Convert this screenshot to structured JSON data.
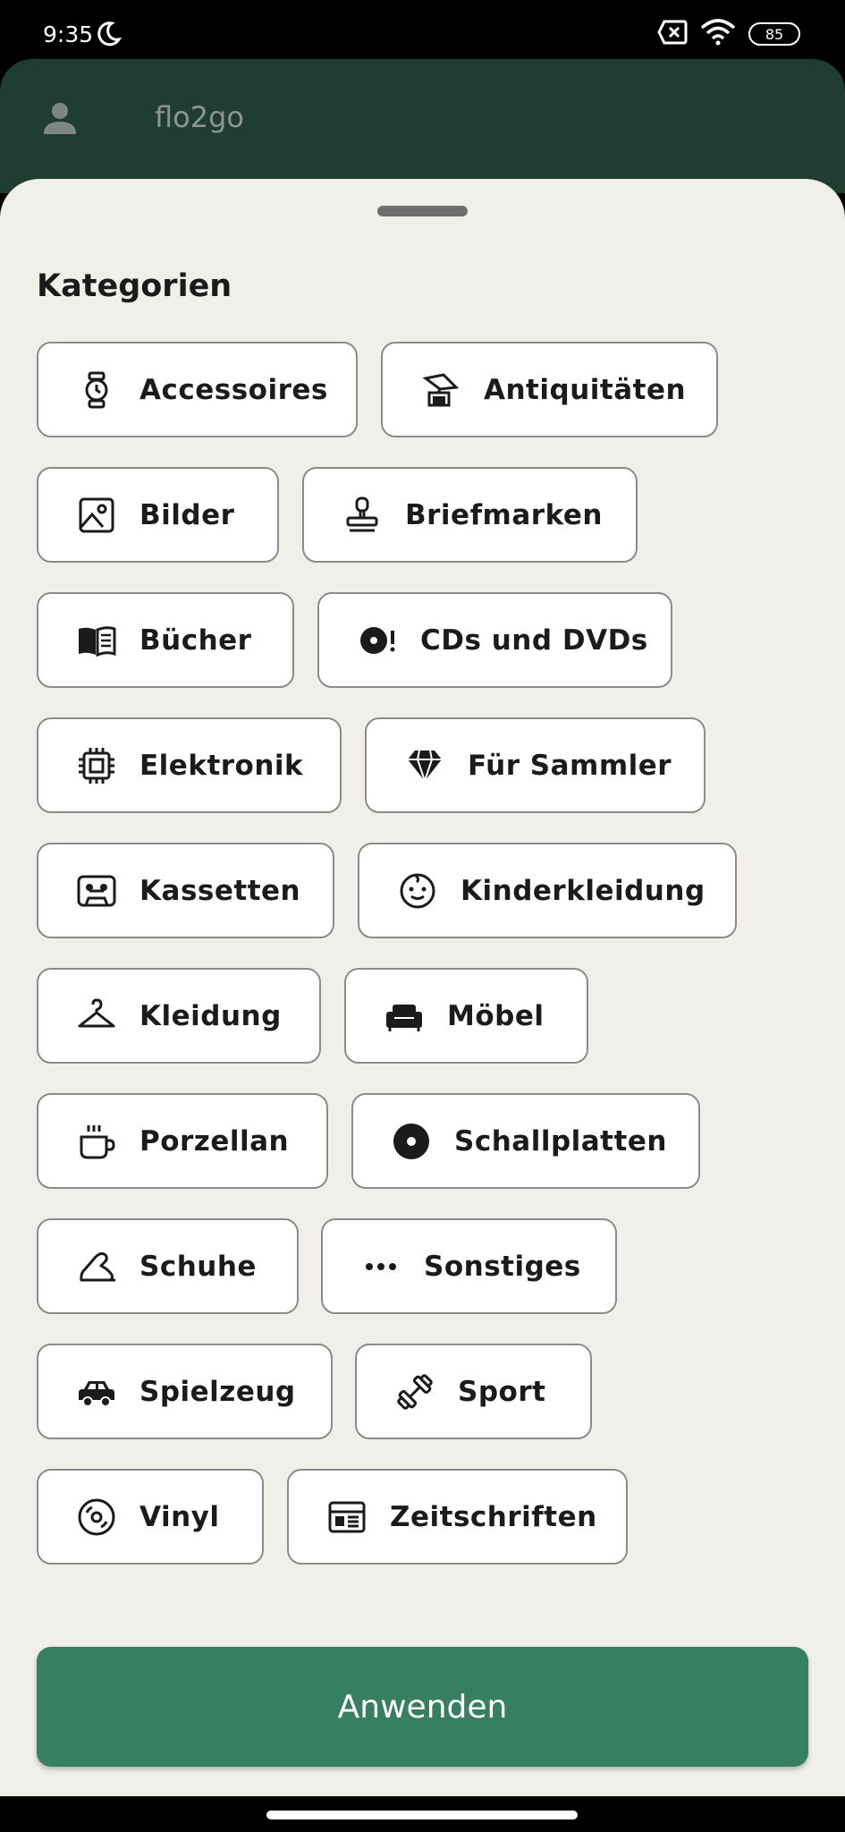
{
  "status_bar": {
    "time": "9:35",
    "battery": "85"
  },
  "header": {
    "title": "flo2go"
  },
  "sheet": {
    "section_title": "Kategorien",
    "categories": [
      {
        "label": "Accessoires",
        "icon": "watch-icon"
      },
      {
        "label": "Antiquitäten",
        "icon": "antique-gramophone-icon"
      },
      {
        "label": "Bilder",
        "icon": "image-icon"
      },
      {
        "label": "Briefmarken",
        "icon": "stamp-icon"
      },
      {
        "label": "Bücher",
        "icon": "book-icon"
      },
      {
        "label": "CDs und DVDs",
        "icon": "disc-alert-icon"
      },
      {
        "label": "Elektronik",
        "icon": "chip-icon"
      },
      {
        "label": "Für Sammler",
        "icon": "diamond-icon"
      },
      {
        "label": "Kassetten",
        "icon": "cassette-icon"
      },
      {
        "label": "Kinderkleidung",
        "icon": "baby-face-icon"
      },
      {
        "label": "Kleidung",
        "icon": "hanger-icon"
      },
      {
        "label": "Möbel",
        "icon": "sofa-icon"
      },
      {
        "label": "Porzellan",
        "icon": "cup-icon"
      },
      {
        "label": "Schallplatten",
        "icon": "record-icon"
      },
      {
        "label": "Schuhe",
        "icon": "shoe-icon"
      },
      {
        "label": "Sonstiges",
        "icon": "more-dots-icon"
      },
      {
        "label": "Spielzeug",
        "icon": "toy-car-icon"
      },
      {
        "label": "Sport",
        "icon": "dumbbell-icon"
      },
      {
        "label": "Vinyl",
        "icon": "vinyl-icon"
      },
      {
        "label": "Zeitschriften",
        "icon": "newspaper-icon"
      }
    ]
  },
  "apply_button": {
    "label": "Anwenden"
  },
  "colors": {
    "header_bg": "#1f3d31",
    "sheet_bg": "#f1efea",
    "accent": "#367f63"
  }
}
